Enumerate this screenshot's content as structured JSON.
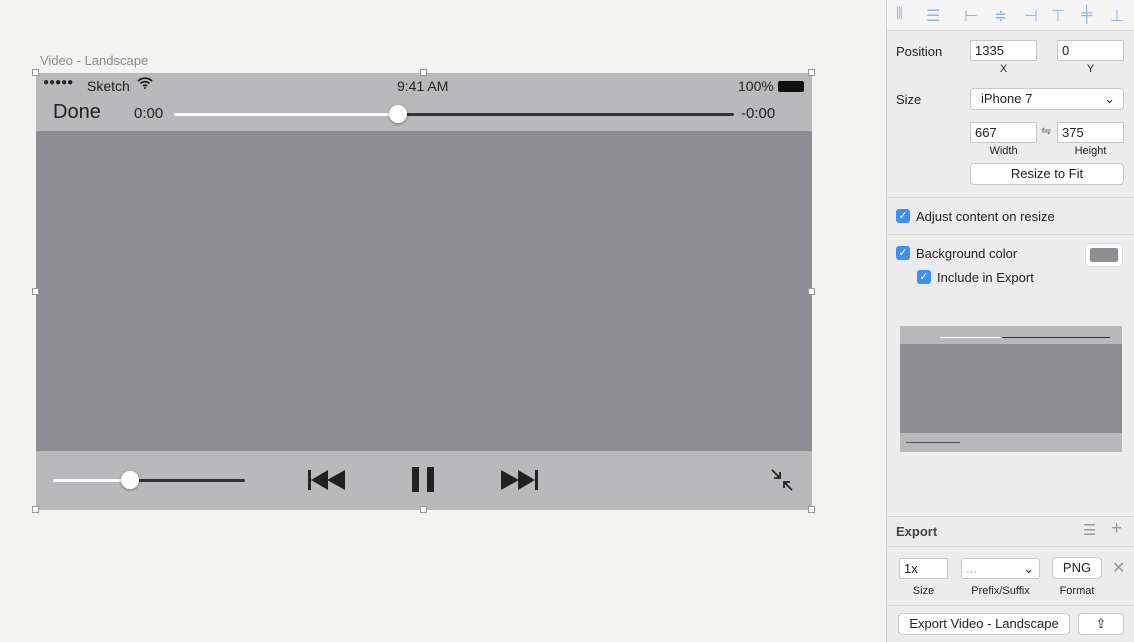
{
  "canvas": {
    "artboard_name": "Video - Landscape"
  },
  "artboard": {
    "background": "#8e8d92",
    "bar_color": "#b9b9bb",
    "status": {
      "signal": "●●●●●",
      "carrier": "Sketch",
      "time": "9:41 AM",
      "battery": "100%"
    },
    "nav": {
      "done": "Done",
      "elapsed": "0:00",
      "remaining": "-0:00",
      "progress": 0.4
    },
    "controls": {
      "volume": 0.4
    }
  },
  "inspector": {
    "position_label": "Position",
    "x": "1335",
    "y": "0",
    "x_label": "X",
    "y_label": "Y",
    "size_label": "Size",
    "size_preset": "iPhone 7",
    "width": "667",
    "height": "375",
    "width_label": "Width",
    "height_label": "Height",
    "resize_to_fit": "Resize to Fit",
    "adjust_content": "Adjust content on resize",
    "background_color": "Background color",
    "background_swatch": "#8e8d92",
    "include_export": "Include in Export",
    "export": {
      "title": "Export",
      "scale": "1x",
      "prefix": "...",
      "format": "PNG",
      "size_label": "Size",
      "prefix_label": "Prefix/Suffix",
      "format_label": "Format",
      "export_button": "Export Video - Landscape"
    }
  }
}
